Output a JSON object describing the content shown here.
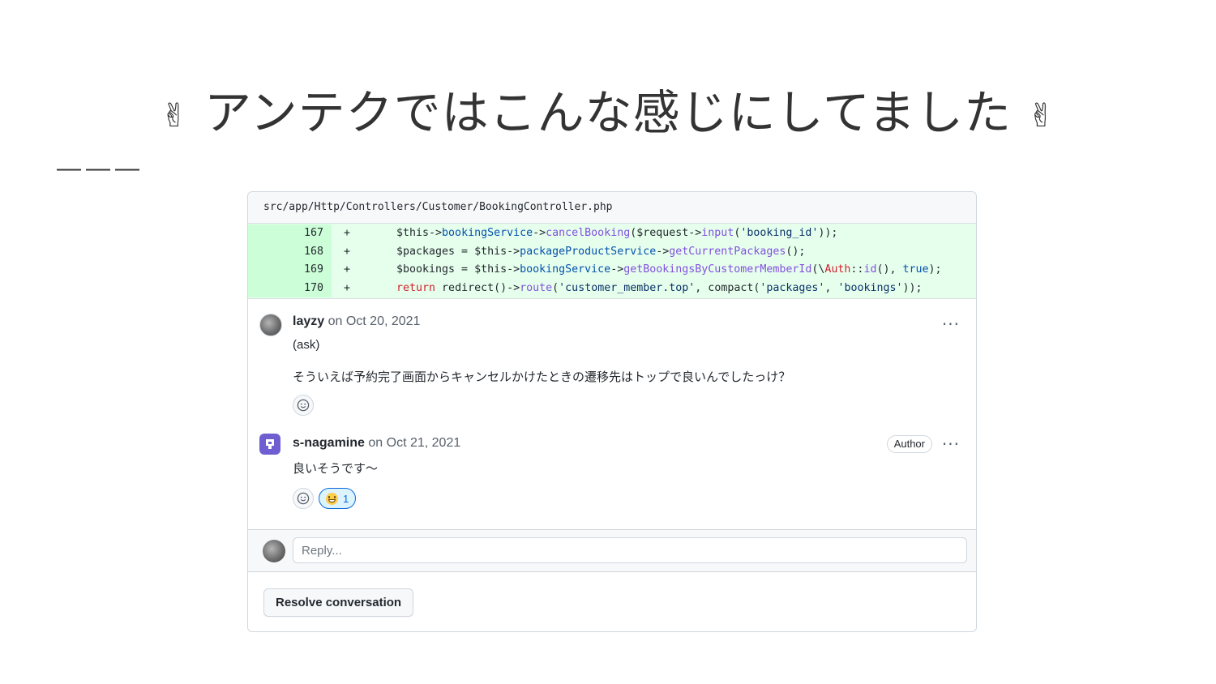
{
  "slide": {
    "title": "アンテクではこんな感じにしてました",
    "title_emoji": "✌",
    "divider": "———"
  },
  "review": {
    "file_path": "src/app/Http/Controllers/Customer/BookingController.php",
    "diff_sign": "+",
    "lines": [
      {
        "number": "167"
      },
      {
        "number": "168"
      },
      {
        "number": "169"
      },
      {
        "number": "170"
      }
    ],
    "code_tokens": {
      "l167": [
        "$this->",
        "bookingService",
        "->",
        "cancelBooking",
        "($request->",
        "input",
        "(",
        "'booking_id'",
        "));"
      ],
      "l168": [
        "$packages = $this->",
        "packageProductService",
        "->",
        "getCurrentPackages",
        "();"
      ],
      "l169": [
        "$bookings = $this->",
        "bookingService",
        "->",
        "getBookingsByCustomerMemberId",
        "(\\",
        "Auth",
        "::",
        "id",
        "(), ",
        "true",
        ");"
      ],
      "l170": [
        "return",
        " redirect()->",
        "route",
        "(",
        "'customer_member.top'",
        ", compact(",
        "'packages'",
        ", ",
        "'bookings'",
        "));"
      ]
    },
    "comments": [
      {
        "author": "layzy",
        "date": "on Oct 20, 2021",
        "tag": "(ask)",
        "body": "そういえば予約完了画面からキャンセルかけたときの遷移先はトップで良いんでしたっけ？",
        "menu": "···"
      },
      {
        "author": "s-nagamine",
        "date": "on Oct 21, 2021",
        "badge": "Author",
        "body": "良いそうです〜",
        "menu": "···",
        "reaction_count": "1",
        "reaction_icon": "grinning-face-icon"
      }
    ],
    "reply_placeholder": "Reply...",
    "resolve_label": "Resolve conversation"
  },
  "colors": {
    "diff_bg": "#e6ffec",
    "diff_num_bg": "#ccffd8",
    "org_avatar": "#6e5ed1",
    "reaction_accent": "#0969da"
  }
}
